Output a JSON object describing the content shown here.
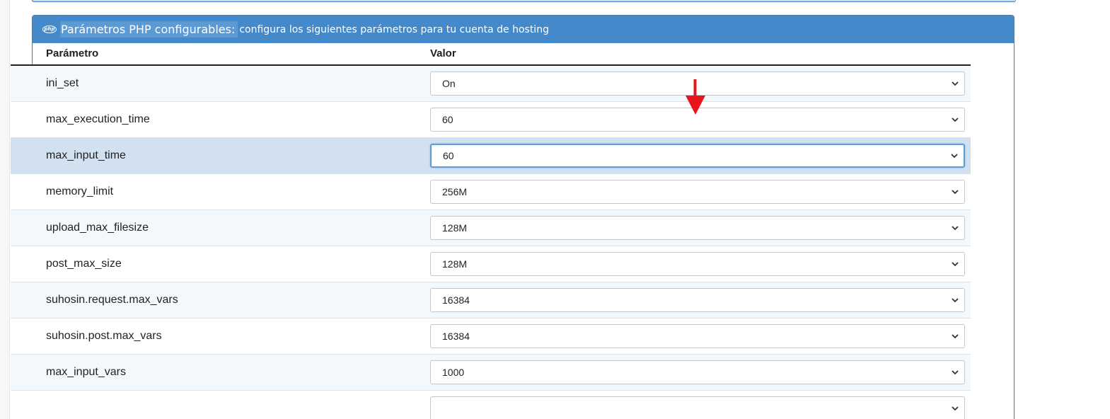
{
  "panel": {
    "heading_strong": "Parámetros PHP configurables:",
    "heading_rest": " configura los siguientes parámetros para tu cuenta de hosting",
    "icon_text": "php"
  },
  "table": {
    "headers": [
      "Parámetro",
      "Valor"
    ],
    "rows": [
      {
        "param": "ini_set",
        "value": "On"
      },
      {
        "param": "max_execution_time",
        "value": "60"
      },
      {
        "param": "max_input_time",
        "value": "60"
      },
      {
        "param": "memory_limit",
        "value": "256M"
      },
      {
        "param": "upload_max_filesize",
        "value": "128M"
      },
      {
        "param": "post_max_size",
        "value": "128M"
      },
      {
        "param": "suhosin.request.max_vars",
        "value": "16384"
      },
      {
        "param": "suhosin.post.max_vars",
        "value": "16384"
      },
      {
        "param": "max_input_vars",
        "value": "1000"
      },
      {
        "param": "",
        "value": ""
      }
    ]
  },
  "colors": {
    "heading_bg": "#4489ca",
    "annotation_arrow": "#e8141b"
  },
  "icons": {
    "php": "php-logo-icon",
    "select": "chevron-down-icon",
    "annotation": "red-arrow-icon"
  }
}
